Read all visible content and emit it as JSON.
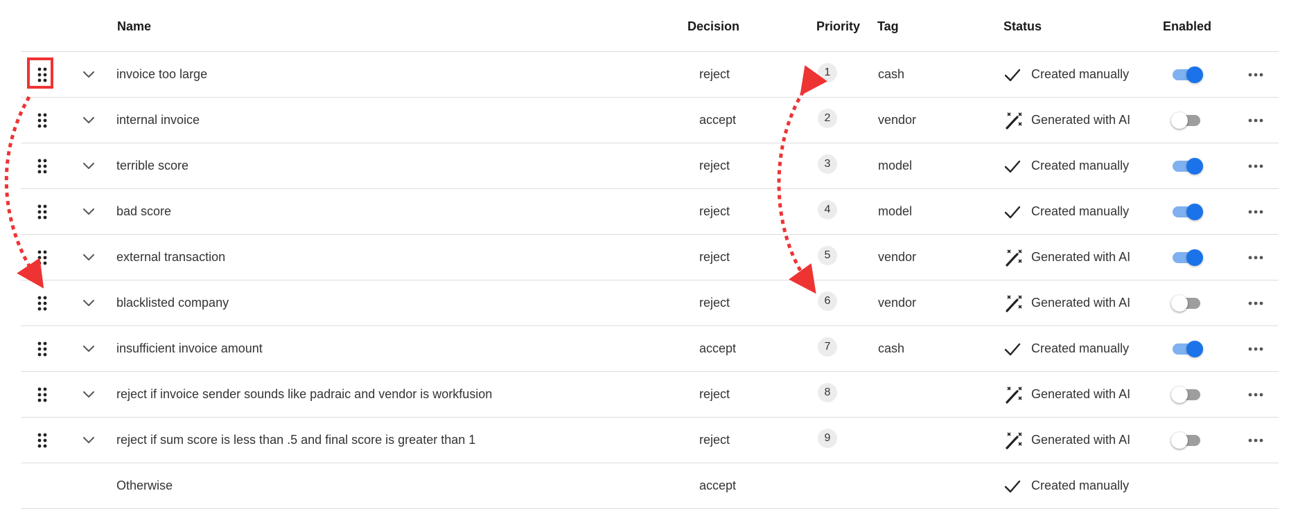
{
  "columns": {
    "name": "Name",
    "decision": "Decision",
    "priority": "Priority",
    "tag": "Tag",
    "status": "Status",
    "enabled": "Enabled"
  },
  "rules": [
    {
      "name": "invoice too large",
      "decision": "reject",
      "priority": "1",
      "tag": "cash",
      "status": "Created manually",
      "status_icon": "check-icon",
      "enabled": true
    },
    {
      "name": "internal invoice",
      "decision": "accept",
      "priority": "2",
      "tag": "vendor",
      "status": "Generated with AI",
      "status_icon": "magic-wand-icon",
      "enabled": false
    },
    {
      "name": "terrible score",
      "decision": "reject",
      "priority": "3",
      "tag": "model",
      "status": "Created manually",
      "status_icon": "check-icon",
      "enabled": true
    },
    {
      "name": "bad score",
      "decision": "reject",
      "priority": "4",
      "tag": "model",
      "status": "Created manually",
      "status_icon": "check-icon",
      "enabled": true
    },
    {
      "name": "external transaction",
      "decision": "reject",
      "priority": "5",
      "tag": "vendor",
      "status": "Generated with AI",
      "status_icon": "magic-wand-icon",
      "enabled": true
    },
    {
      "name": "blacklisted company",
      "decision": "reject",
      "priority": "6",
      "tag": "vendor",
      "status": "Generated with AI",
      "status_icon": "magic-wand-icon",
      "enabled": false
    },
    {
      "name": "insufficient invoice amount",
      "decision": "accept",
      "priority": "7",
      "tag": "cash",
      "status": "Created manually",
      "status_icon": "check-icon",
      "enabled": true
    },
    {
      "name": "reject if invoice sender sounds like padraic and vendor is workfusion",
      "decision": "reject",
      "priority": "8",
      "tag": "",
      "status": "Generated with AI",
      "status_icon": "magic-wand-icon",
      "enabled": false
    },
    {
      "name": "reject if sum score is less than .5 and final score is greater than 1",
      "decision": "reject",
      "priority": "9",
      "tag": "",
      "status": "Generated with AI",
      "status_icon": "magic-wand-icon",
      "enabled": false
    }
  ],
  "fallback": {
    "name": "Otherwise",
    "decision": "accept",
    "status": "Created manually",
    "status_icon": "check-icon"
  },
  "icons": {
    "drag": "drag-handle-icon",
    "expand": "chevron-down-icon",
    "more": "more-horizontal-icon"
  },
  "colors": {
    "toggle_on": "#1a73e8",
    "toggle_on_track": "#7fb0f0",
    "toggle_off_track": "#9e9e9e",
    "annotation": "#ee3333"
  }
}
